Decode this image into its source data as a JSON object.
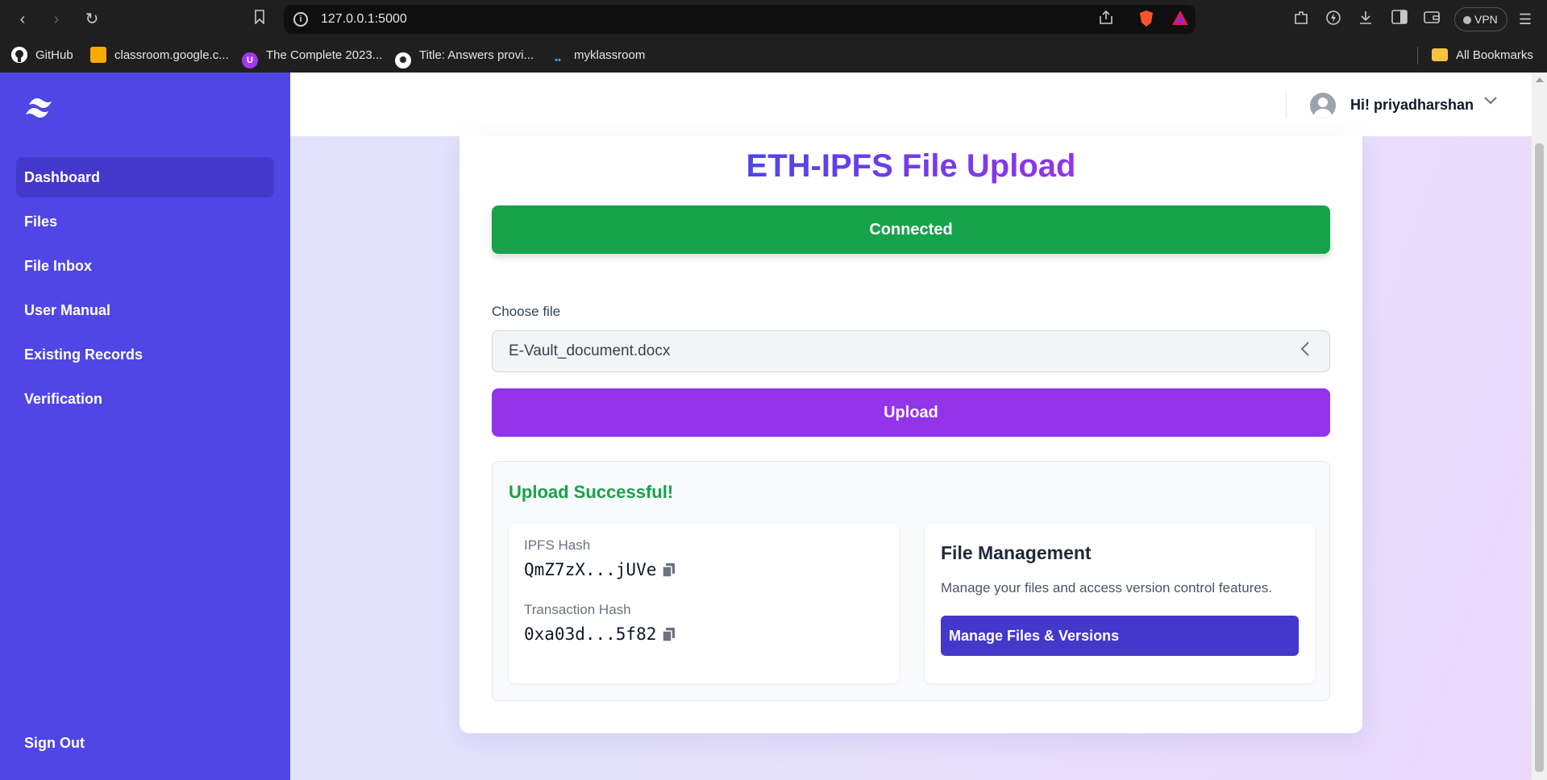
{
  "browser": {
    "url": "127.0.0.1:5000",
    "vpn_label": "VPN",
    "bookmarks": [
      {
        "label": "GitHub"
      },
      {
        "label": "classroom.google.c..."
      },
      {
        "label": "The Complete 2023..."
      },
      {
        "label": "Title: Answers provi..."
      },
      {
        "label": "myklassroom"
      }
    ],
    "all_bookmarks": "All Bookmarks"
  },
  "sidebar": {
    "items": [
      {
        "label": "Dashboard",
        "active": true
      },
      {
        "label": "Files"
      },
      {
        "label": "File Inbox"
      },
      {
        "label": "User Manual"
      },
      {
        "label": "Existing Records"
      },
      {
        "label": "Verification"
      }
    ],
    "sign_out": "Sign Out",
    "color": "#4f46e5"
  },
  "header": {
    "greeting": "Hi! priyadharshan"
  },
  "main": {
    "title": "ETH-IPFS File Upload",
    "connected_label": "Connected",
    "choose_file_label": "Choose file",
    "file_name": "E-Vault_document.docx",
    "upload_label": "Upload",
    "result": {
      "title": "Upload Successful!",
      "ipfs_label": "IPFS Hash",
      "ipfs_value": "QmZ7zX...jUVe",
      "tx_label": "Transaction Hash",
      "tx_value": "0xa03d...5f82"
    },
    "file_management": {
      "title": "File Management",
      "description": "Manage your files and access version control features.",
      "button": "Manage Files & Versions"
    }
  },
  "colors": {
    "success": "#16a34a",
    "upload": "#9333ea",
    "primary": "#4f46e5",
    "primary_dark": "#4338ca"
  }
}
